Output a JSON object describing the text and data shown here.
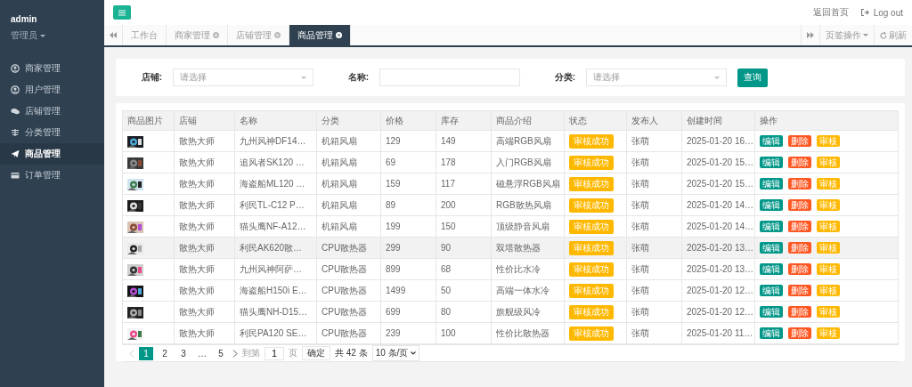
{
  "sidebar": {
    "user": "admin",
    "role": "管理员",
    "items": [
      {
        "label": "商家管理",
        "selected": false
      },
      {
        "label": "用户管理",
        "selected": false
      },
      {
        "label": "店铺管理",
        "selected": false
      },
      {
        "label": "分类管理",
        "selected": false
      },
      {
        "label": "商品管理",
        "selected": true
      },
      {
        "label": "订单管理",
        "selected": false
      }
    ]
  },
  "topbar": {
    "home_link": "返回首页",
    "logout": "Log out"
  },
  "tabs": [
    {
      "label": "工作台",
      "closable": false,
      "selected": false
    },
    {
      "label": "商家管理",
      "closable": true,
      "selected": false
    },
    {
      "label": "店铺管理",
      "closable": true,
      "selected": false
    },
    {
      "label": "商品管理",
      "closable": true,
      "selected": true
    }
  ],
  "tab_actions": {
    "menu": "页签操作",
    "refresh": "刷新"
  },
  "filters": [
    {
      "label": "店铺:",
      "kind": "select",
      "placeholder": "请选择"
    },
    {
      "label": "名称:",
      "kind": "input"
    },
    {
      "label": "分类:",
      "kind": "select",
      "placeholder": "请选择"
    }
  ],
  "search_button": "查询",
  "table": {
    "columns": [
      "商品图片",
      "店铺",
      "名称",
      "分类",
      "价格",
      "库存",
      "商品介绍",
      "状态",
      "发布人",
      "创建时间",
      "操作"
    ],
    "rows": [
      {
        "shop": "散热大师",
        "name": "九州风神DF14…",
        "category": "机箱风扇",
        "price": "129",
        "stock": "149",
        "intro": "高端RGB风扇",
        "status": "审核成功",
        "publisher": "张萌",
        "created": "2025-01-20 16…",
        "actions": [
          "编辑",
          "删除",
          "审核"
        ],
        "selected": false
      },
      {
        "shop": "散热大师",
        "name": "追风者SK120 …",
        "category": "机箱风扇",
        "price": "69",
        "stock": "178",
        "intro": "入门RGB风扇",
        "status": "审核成功",
        "publisher": "张萌",
        "created": "2025-01-20 15…",
        "actions": [
          "编辑",
          "删除",
          "审核"
        ],
        "selected": false
      },
      {
        "shop": "散热大师",
        "name": "海盗船ML120 …",
        "category": "机箱风扇",
        "price": "159",
        "stock": "117",
        "intro": "磁悬浮RGB风扇",
        "status": "审核成功",
        "publisher": "张萌",
        "created": "2025-01-20 15…",
        "actions": [
          "编辑",
          "删除",
          "审核"
        ],
        "selected": false
      },
      {
        "shop": "散热大师",
        "name": "利民TL-C12 P…",
        "category": "机箱风扇",
        "price": "89",
        "stock": "200",
        "intro": "RGB散热风扇",
        "status": "审核成功",
        "publisher": "张萌",
        "created": "2025-01-20 14…",
        "actions": [
          "编辑",
          "删除",
          "审核"
        ],
        "selected": false
      },
      {
        "shop": "散热大师",
        "name": "猫头鹰NF-A12…",
        "category": "机箱风扇",
        "price": "199",
        "stock": "150",
        "intro": "顶级静音风扇",
        "status": "审核成功",
        "publisher": "张萌",
        "created": "2025-01-20 14…",
        "actions": [
          "编辑",
          "删除",
          "审核"
        ],
        "selected": false
      },
      {
        "shop": "散热大师",
        "name": "利民AK620散…",
        "category": "CPU散热器",
        "price": "299",
        "stock": "90",
        "intro": "双塔散热器",
        "status": "审核成功",
        "publisher": "张萌",
        "created": "2025-01-20 13…",
        "actions": [
          "编辑",
          "删除",
          "审核"
        ],
        "selected": true
      },
      {
        "shop": "散热大师",
        "name": "九州风神阿萨…",
        "category": "CPU散热器",
        "price": "899",
        "stock": "68",
        "intro": "性价比水冷",
        "status": "审核成功",
        "publisher": "张萌",
        "created": "2025-01-20 13…",
        "actions": [
          "编辑",
          "删除",
          "审核"
        ],
        "selected": false
      },
      {
        "shop": "散热大师",
        "name": "海盗船H150i E…",
        "category": "CPU散热器",
        "price": "1499",
        "stock": "50",
        "intro": "高端一体水冷",
        "status": "审核成功",
        "publisher": "张萌",
        "created": "2025-01-20 12…",
        "actions": [
          "编辑",
          "删除",
          "审核"
        ],
        "selected": false
      },
      {
        "shop": "散热大师",
        "name": "猫头鹰NH-D15…",
        "category": "CPU散热器",
        "price": "699",
        "stock": "80",
        "intro": "旗舰级风冷",
        "status": "审核成功",
        "publisher": "张萌",
        "created": "2025-01-20 12…",
        "actions": [
          "编辑",
          "删除",
          "审核"
        ],
        "selected": false
      },
      {
        "shop": "散热大师",
        "name": "利民PA120 SE…",
        "category": "CPU散热器",
        "price": "239",
        "stock": "100",
        "intro": "性价比散热器",
        "status": "审核成功",
        "publisher": "张萌",
        "created": "2025-01-20 11…",
        "actions": [
          "编辑",
          "删除",
          "审核"
        ],
        "selected": false
      }
    ]
  },
  "pager": {
    "pages": [
      {
        "label": "1",
        "selected": true
      },
      {
        "label": "2",
        "selected": false
      },
      {
        "label": "3",
        "selected": false
      },
      {
        "label": "…",
        "selected": false
      },
      {
        "label": "5",
        "selected": false
      }
    ],
    "goto_label": "到第",
    "goto_value": "1",
    "page_unit": "页",
    "confirm": "确定",
    "total": "共 42 条",
    "page_size": "10 条/页"
  }
}
